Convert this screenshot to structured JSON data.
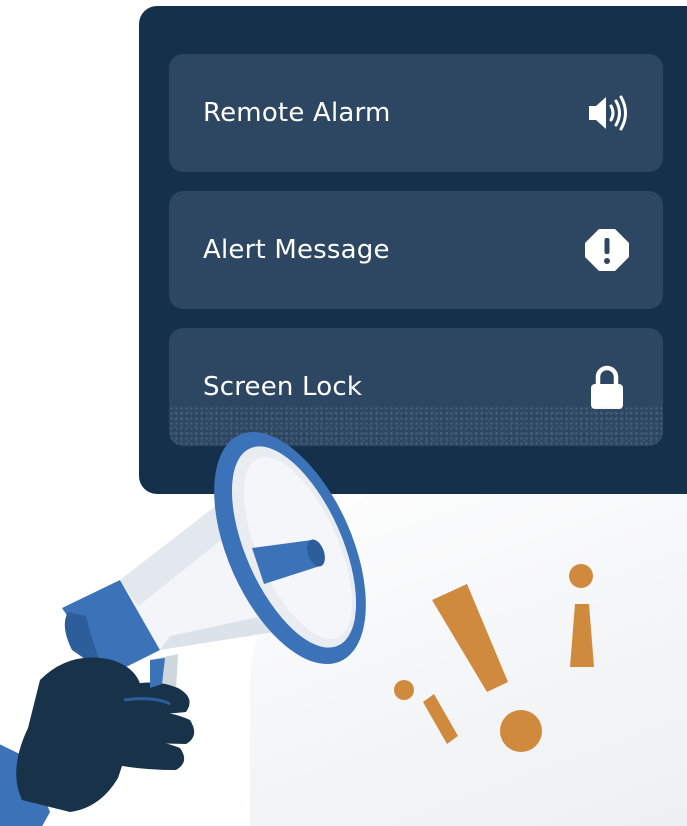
{
  "alert_options": [
    {
      "label": "Remote Alarm",
      "icon": "speaker-icon"
    },
    {
      "label": "Alert Message",
      "icon": "alert-octagon-icon"
    },
    {
      "label": "Screen Lock",
      "icon": "lock-icon"
    }
  ],
  "colors": {
    "panel_bg": "#14304b",
    "card_bg": "#2d4762",
    "megaphone_blue": "#3b72b8",
    "hand_navy": "#183249",
    "accent_orange": "#d08a3e"
  }
}
